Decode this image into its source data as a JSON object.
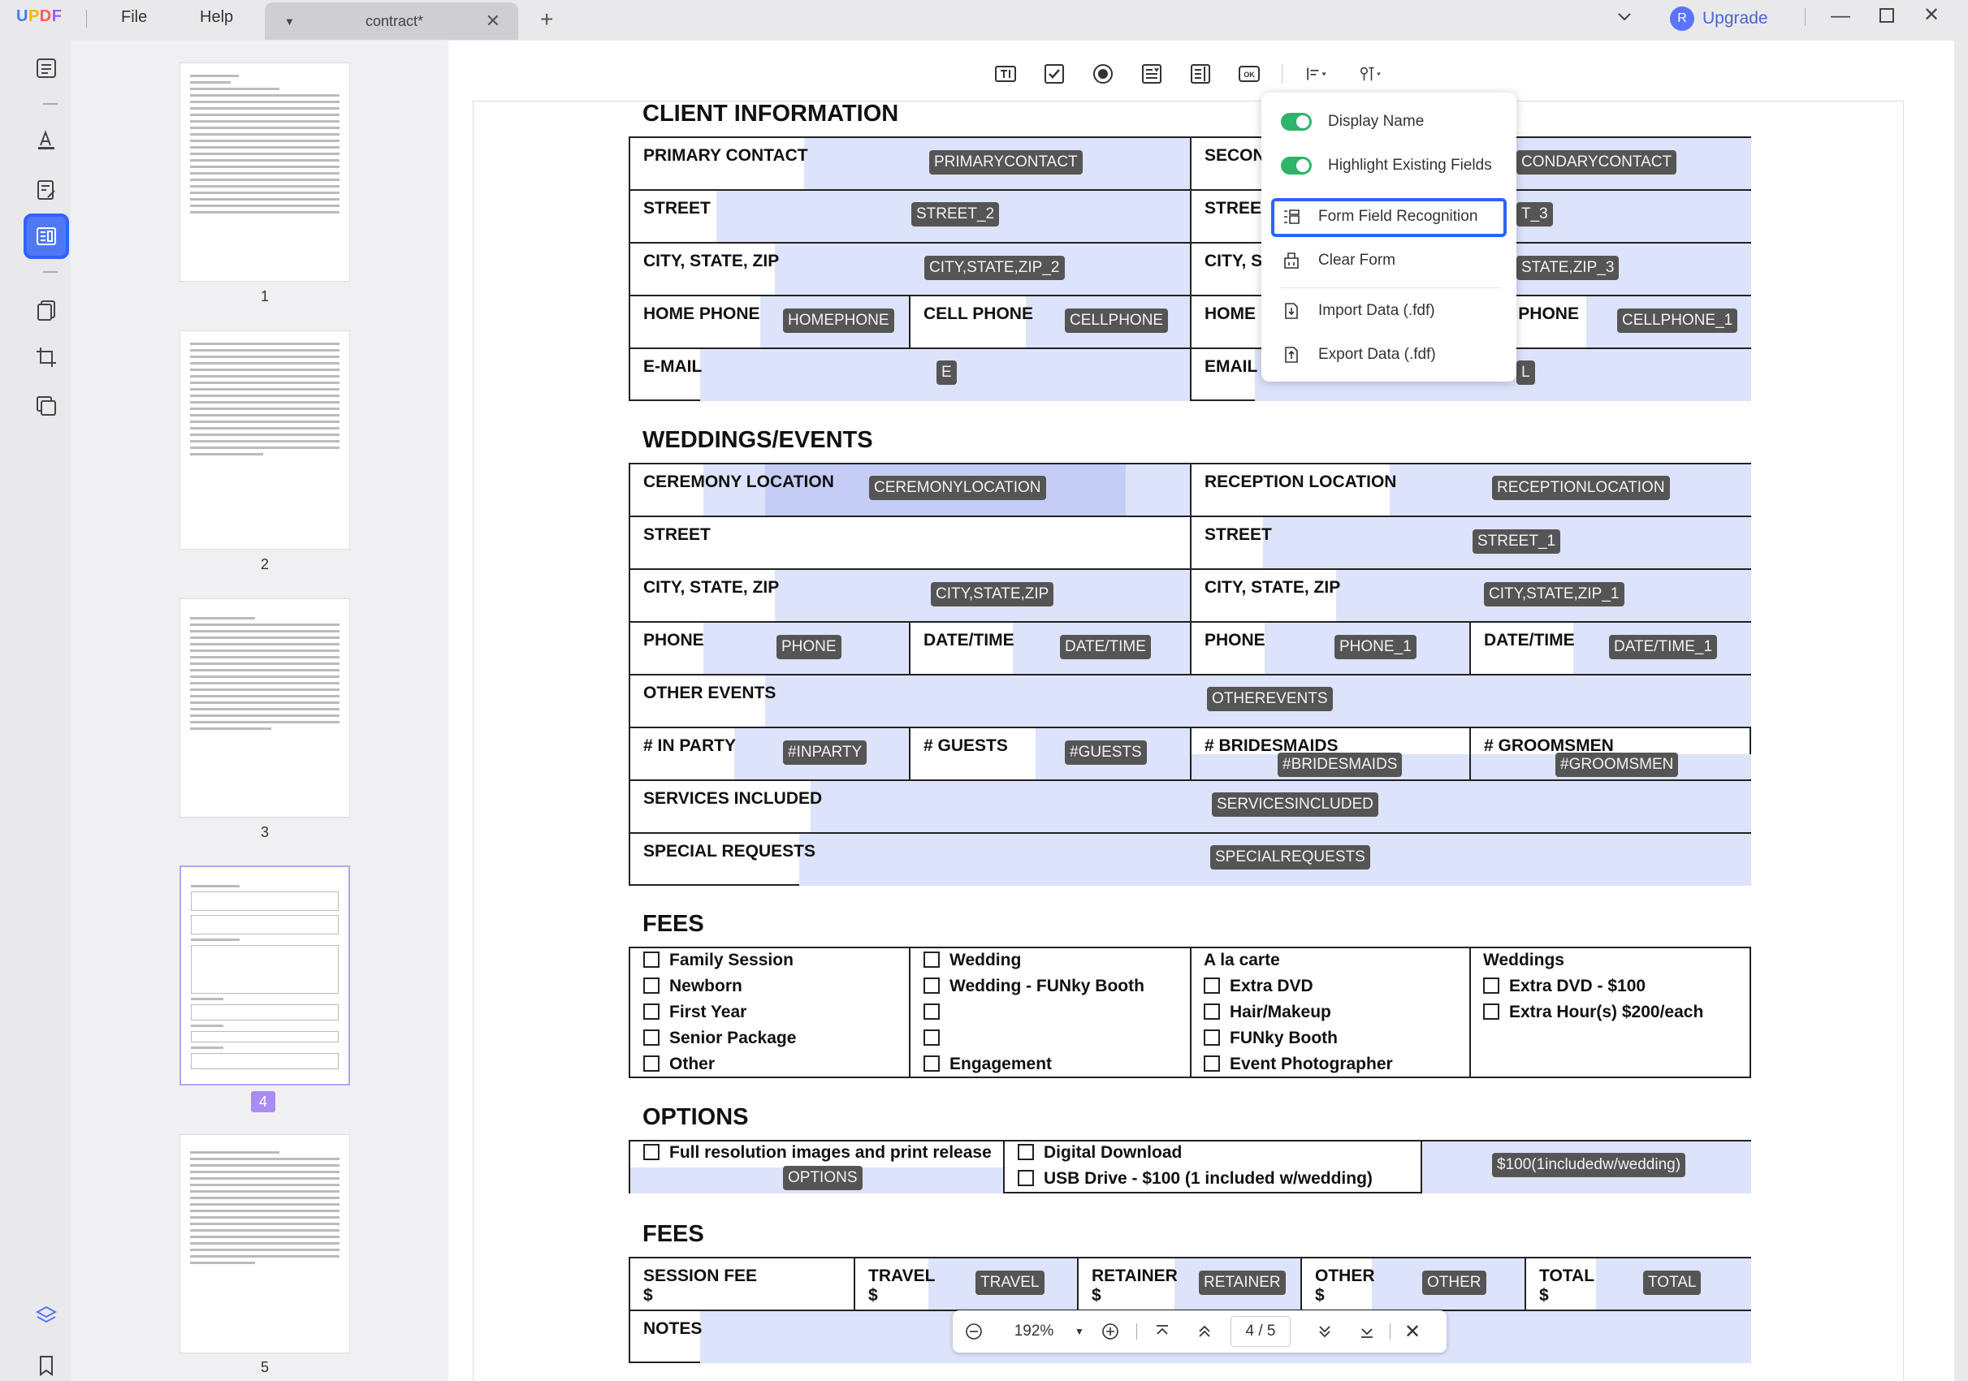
{
  "app": {
    "logo": "UPDF",
    "menu_file": "File",
    "menu_help": "Help",
    "tab_name": "contract*",
    "upgrade": "Upgrade",
    "avatar": "R"
  },
  "thumbs": {
    "n1": "1",
    "n2": "2",
    "n3": "3",
    "n4": "4",
    "n5": "5"
  },
  "popup": {
    "display_name": "Display Name",
    "highlight": "Highlight Existing Fields",
    "recognition": "Form Field Recognition",
    "clear": "Clear Form",
    "import": "Import Data (.fdf)",
    "export": "Export Data (.fdf)"
  },
  "client": {
    "title": "CLIENT INFORMATION",
    "primary_contact": "PRIMARY CONTACT",
    "primary_tag": "PRIMARYCONTACT",
    "secondary_contact": "SECON",
    "secondary_tag": "CONDARYCONTACT",
    "street": "STREET",
    "street2_tag": "STREET_2",
    "street_b": "STREET",
    "street3_tag": "T_3",
    "city": "CITY, STATE, ZIP",
    "city2_tag": "CITY,STATE,ZIP_2",
    "city_b": "CITY, ST",
    "city3_tag": "STATE,ZIP_3",
    "home_phone": "HOME PHONE",
    "home_tag": "HOMEPHONE",
    "cell_phone": "CELL PHONE",
    "cell_tag": "CELLPHONE",
    "home_b": "HOME",
    "cell_b": "L PHONE",
    "cell1_tag": "CELLPHONE_1",
    "email": "E-MAIL",
    "email_tag": "E",
    "email_b": "EMAIL",
    "email_b_tag": "L"
  },
  "events": {
    "title": "WEDDINGS/EVENTS",
    "ceremony": "CEREMONY LOCATION",
    "ceremony_tag": "CEREMONYLOCATION",
    "reception": "RECEPTION LOCATION",
    "reception_tag": "RECEPTIONLOCATION",
    "street": "STREET",
    "street_b": "STREET",
    "street1_tag": "STREET_1",
    "city": "CITY, STATE, ZIP",
    "city_tag": "CITY,STATE,ZIP",
    "city_b": "CITY, STATE, ZIP",
    "city1_tag": "CITY,STATE,ZIP_1",
    "phone": "PHONE",
    "phone_tag": "PHONE",
    "datetime": "DATE/TIME",
    "datetime_tag": "DATE/TIME",
    "phone_b": "PHONE",
    "phone1_tag": "PHONE_1",
    "datetime_b": "DATE/TIME",
    "datetime1_tag": "DATE/TIME_1",
    "other": "OTHER EVENTS",
    "other_tag": "OTHEREVENTS",
    "inparty": "# IN PARTY",
    "inparty_tag": "#INPARTY",
    "guests": "# GUESTS",
    "guests_tag": "#GUESTS",
    "bridesmaids": "# BRIDESMAIDS",
    "bridesmaids_tag": "#BRIDESMAIDS",
    "groomsmen": "# GROOMSMEN",
    "groomsmen_tag": "#GROOMSMEN",
    "services": "SERVICES INCLUDED",
    "services_tag": "SERVICESINCLUDED",
    "special": "SPECIAL REQUESTS",
    "special_tag": "SPECIALREQUESTS"
  },
  "fees1": {
    "title": "FEES",
    "col1": [
      "Family Session",
      "Newborn",
      "First Year",
      "Senior Package",
      "Other"
    ],
    "col2": [
      "Wedding",
      "Wedding - FUNky Booth",
      "",
      "",
      "Engagement"
    ],
    "col3_head": "A la carte",
    "col3": [
      "Extra DVD",
      "Hair/Makeup",
      "FUNky Booth",
      "Event Photographer"
    ],
    "col4_head": "Weddings",
    "col4": [
      "Extra DVD - $100",
      "Extra Hour(s) $200/each"
    ]
  },
  "options": {
    "title": "OPTIONS",
    "full_res": "Full resolution images and print release",
    "options_tag": "OPTIONS",
    "digital": "Digital Download",
    "usb": "USB Drive - $100 (1 included w/wedding)",
    "usb_tag": "$100(1includedw/wedding)"
  },
  "fees2": {
    "title": "FEES",
    "session": "SESSION FEE",
    "travel": "TRAVEL",
    "travel_tag": "TRAVEL",
    "retainer": "RETAINER",
    "retainer_tag": "RETAINER",
    "other": "OTHER",
    "other_tag": "OTHER",
    "total": "TOTAL",
    "total_tag": "TOTAL",
    "dollar": "$",
    "notes": "NOTES"
  },
  "zoom": {
    "level": "192%",
    "page": "4 / 5"
  }
}
